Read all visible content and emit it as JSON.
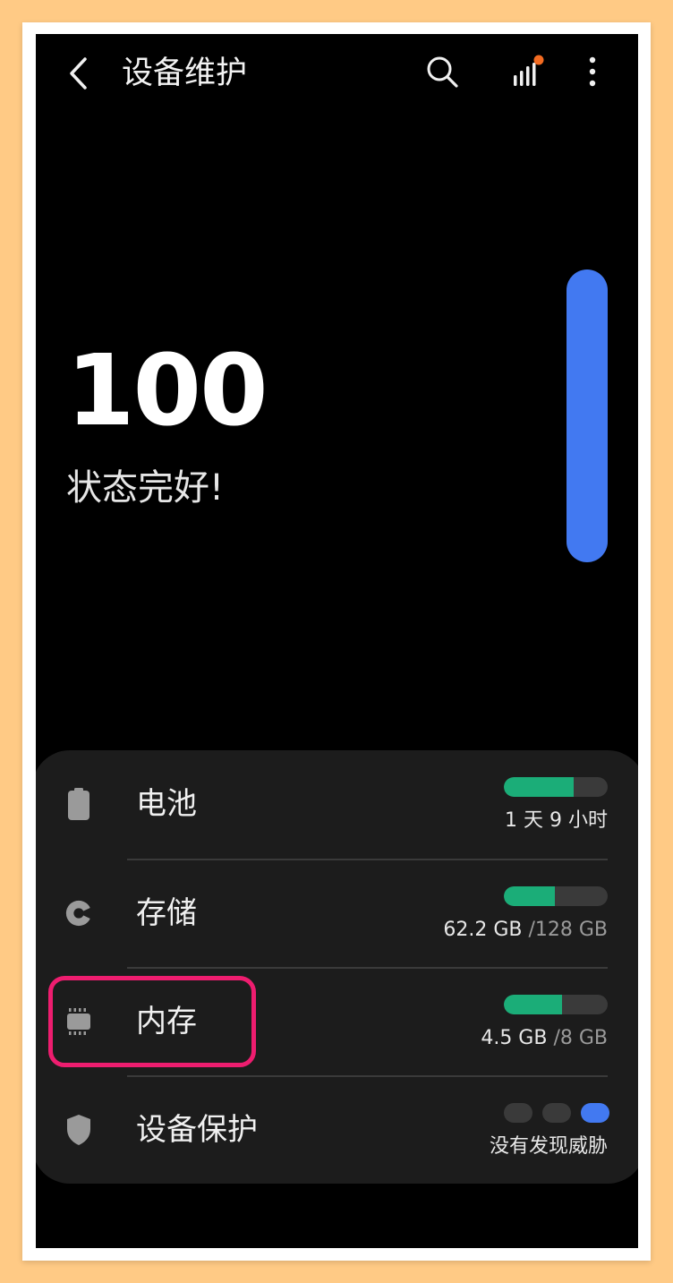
{
  "app": {
    "title": "设备维护",
    "back_icon": "chevron-left-icon",
    "search_icon": "search-icon",
    "stats_icon": "signal-bars-icon",
    "more_icon": "more-vertical-icon"
  },
  "summary": {
    "score": "100",
    "status": "状态完好!",
    "gauge_level": 1.0
  },
  "items": [
    {
      "label": "电池",
      "icon": "battery-icon",
      "value": "1 天 9 小时",
      "bar_fraction": 0.67
    },
    {
      "label": "存储",
      "icon": "storage-pie-icon",
      "value_main": "62.2 GB",
      "value_total": " /128 GB",
      "bar_fraction": 0.49
    },
    {
      "label": "内存",
      "icon": "memory-chip-icon",
      "value_main": "4.5 GB",
      "value_total": " /8 GB",
      "bar_fraction": 0.56
    },
    {
      "label": "设备保护",
      "icon": "shield-icon",
      "value": "没有发现威胁",
      "active_dot_index": 2
    }
  ],
  "colors": {
    "gauge_blue": "#4279F1",
    "bar_green": "#1BAD78",
    "highlight_pink": "#EE1D6F",
    "badge_orange": "#F36B21"
  }
}
